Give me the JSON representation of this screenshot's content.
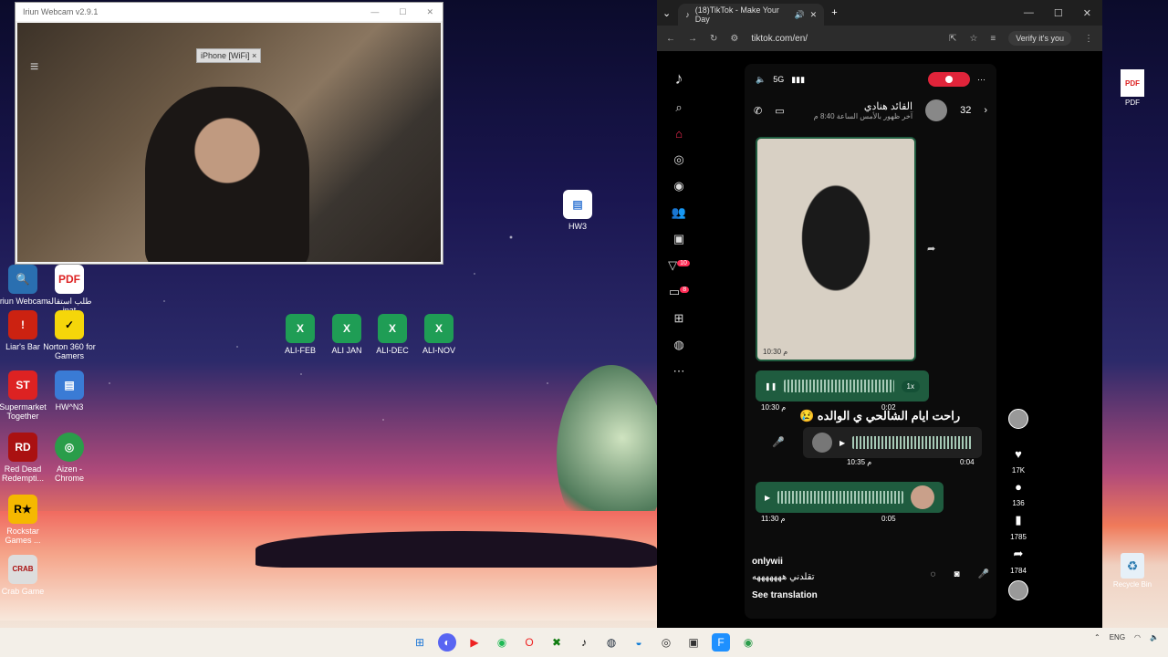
{
  "desktop": {
    "icons_left": [
      {
        "label": "Iriun Webcam",
        "glyph": "🔍",
        "color": "#2a6fb0"
      },
      {
        "label": "طلب استقالة inat",
        "glyph": "PDF",
        "color": "#d22"
      },
      {
        "label": "Liar's Bar",
        "glyph": "!",
        "color": "#c21"
      },
      {
        "label": "Norton 360 for Gamers",
        "glyph": "✓",
        "color": "#f5d60a"
      },
      {
        "label": "Supermarket Together",
        "glyph": "ST",
        "color": "#d22"
      },
      {
        "label": "HW^N3",
        "glyph": "▤",
        "color": "#3a7bd5"
      },
      {
        "label": "Red Dead Redempti...",
        "glyph": "RD",
        "color": "#a11"
      },
      {
        "label": "Aizen - Chrome",
        "glyph": "◎",
        "color": "#2a9d4a"
      },
      {
        "label": "Rockstar Games ...",
        "glyph": "R★",
        "color": "#f5b800"
      },
      {
        "label": "Crab Game",
        "glyph": "CRAB",
        "color": "#ddd"
      }
    ],
    "icons_mid": [
      "ALI-FEB",
      "ALI JAN",
      "ALI-DEC",
      "ALI-NOV"
    ],
    "hw3": "HW3",
    "icons_right": [
      "PDF",
      "Recycle Bin"
    ]
  },
  "webcam": {
    "title": "Iriun Webcam v2.9.1",
    "device": "iPhone [WiFi]"
  },
  "browser": {
    "tab_title": "(18)TikTok - Make Your Day",
    "url": "tiktok.com/en/",
    "verify_label": "Verify it's you"
  },
  "tiktok": {
    "sidebar_badges": {
      "activity": "10",
      "messages": "8"
    },
    "video": {
      "network": "5G",
      "contact_name": "القائد هنادي",
      "contact_status": "آخر ظهور بالأمس الساعة 8:40 م",
      "count": "32",
      "image_time": "10:30 م",
      "voice1": {
        "speed": "1x",
        "time": "10:30 م",
        "duration": "0:02"
      },
      "caption": "راحت ايام الشالحي ي الوالده 😢",
      "voice2": {
        "time": "10:35 م",
        "duration": "0:04"
      },
      "voice3": {
        "time": "11:30 م",
        "duration": "0:05"
      },
      "username": "onlywii",
      "description": "تقلدني هههههههه",
      "see_translation": "See translation"
    },
    "actions": {
      "likes": "17K",
      "comments": "136",
      "saves": "1785",
      "shares": "1784"
    }
  }
}
